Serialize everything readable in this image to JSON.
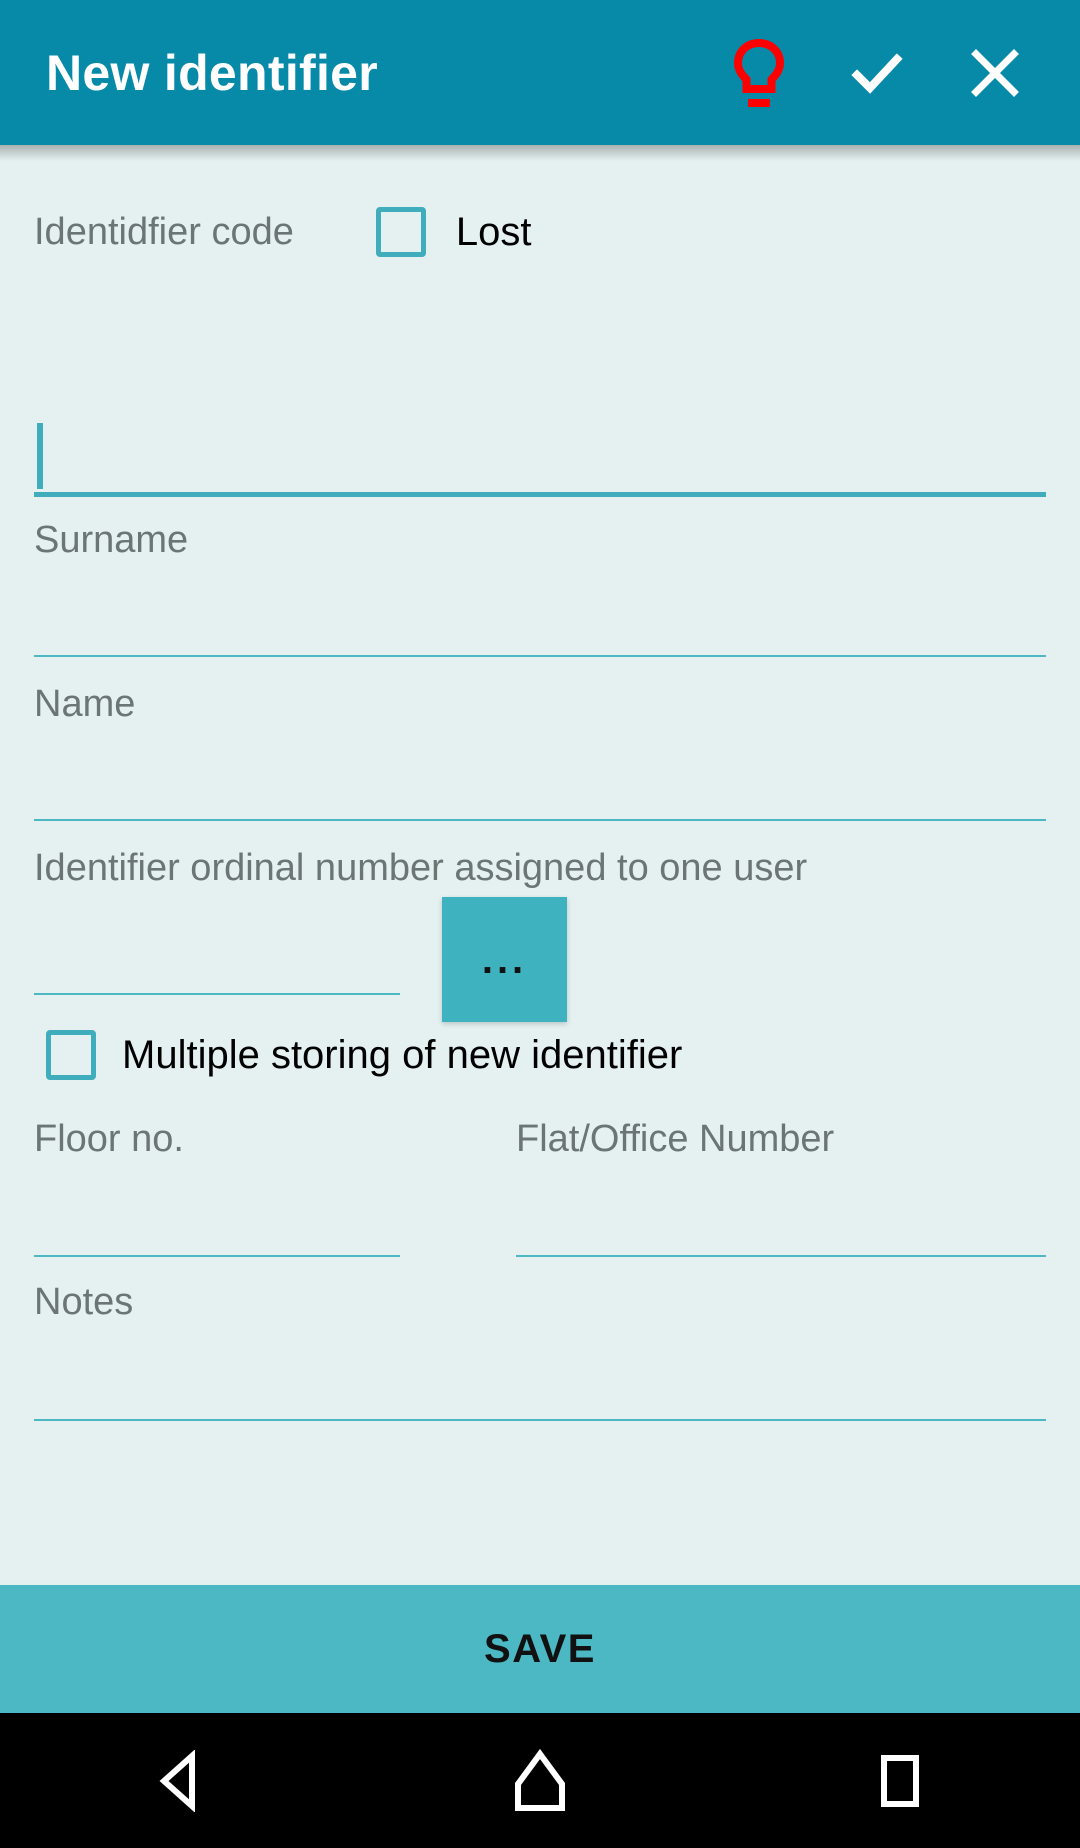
{
  "toolbar": {
    "title": "New identifier",
    "hint_icon": "lightbulb-icon",
    "confirm_icon": "check-icon",
    "close_icon": "close-icon",
    "background_color": "#0789A8",
    "hint_icon_color": "#FF0000",
    "title_color": "#FFFFFF"
  },
  "theme": {
    "background": "#E4F1F0",
    "accent": "#4BB8C4",
    "label_color": "#6B7574",
    "text_color": "#000000"
  },
  "form": {
    "identifier_code": {
      "label": "Identidfier code",
      "value": "",
      "placeholder": "",
      "focused": true
    },
    "lost_checkbox": {
      "label": "Lost",
      "checked": false
    },
    "surname": {
      "label": "Surname",
      "value": "",
      "placeholder": ""
    },
    "name": {
      "label": "Name",
      "value": "",
      "placeholder": ""
    },
    "ordinal_number": {
      "label": "Identifier ordinal number assigned to one user",
      "value": "",
      "placeholder": "",
      "picker_button_label": "...",
      "picker_button_color": "#3FB2BF"
    },
    "multiple_storing_checkbox": {
      "label": "Multiple storing of new identifier",
      "checked": false
    },
    "floor_no": {
      "label": "Floor no.",
      "value": "",
      "placeholder": ""
    },
    "flat_office_number": {
      "label": "Flat/Office Number",
      "value": "",
      "placeholder": ""
    },
    "notes": {
      "label": "Notes",
      "value": "",
      "placeholder": ""
    }
  },
  "save_bar": {
    "label": "SAVE",
    "background_color": "#4BB8C4"
  },
  "navbar": {
    "back_icon": "back-triangle-icon",
    "home_icon": "home-icon",
    "recents_icon": "recents-square-icon",
    "background_color": "#000000"
  }
}
